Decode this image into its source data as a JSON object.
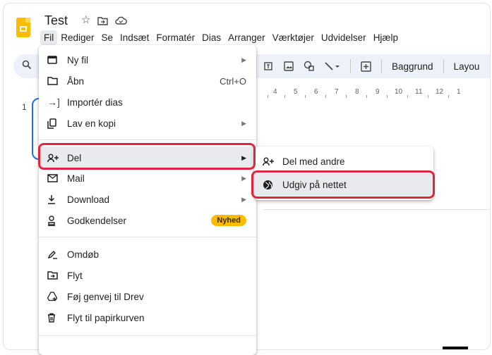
{
  "app": {
    "doc_title": "Test",
    "title_icons": [
      "star-icon",
      "move-to-folder-icon",
      "cloud-status-icon"
    ]
  },
  "menubar": {
    "items": [
      "Fil",
      "Rediger",
      "Se",
      "Indsæt",
      "Formatér",
      "Dias",
      "Arranger",
      "Værktøjer",
      "Udvidelser",
      "Hjælp"
    ]
  },
  "toolbar": {
    "background_label": "Baggrund",
    "layout_label": "Layou"
  },
  "ruler": {
    "numbers": [
      "4",
      "5",
      "6",
      "7",
      "8",
      "9",
      "10",
      "11",
      "12",
      "1"
    ]
  },
  "filmstrip": {
    "slide_number": "1"
  },
  "file_menu": {
    "items": [
      {
        "label": "Ny fil",
        "icon": "slides-icon",
        "has_submenu": true
      },
      {
        "label": "Åbn",
        "icon": "folder-icon",
        "shortcut": "Ctrl+O"
      },
      {
        "label": "Importér dias",
        "icon": "import-icon"
      },
      {
        "label": "Lav en kopi",
        "icon": "copy-icon",
        "has_submenu": true
      },
      {
        "label": "Del",
        "icon": "person-add-icon",
        "has_submenu": true
      },
      {
        "label": "Mail",
        "icon": "mail-icon",
        "has_submenu": true
      },
      {
        "label": "Download",
        "icon": "download-icon",
        "has_submenu": true
      },
      {
        "label": "Godkendelser",
        "icon": "approvals-icon",
        "badge": "Nyhed"
      },
      {
        "label": "Omdøb",
        "icon": "rename-icon"
      },
      {
        "label": "Flyt",
        "icon": "move-folder-icon"
      },
      {
        "label": "Føj genvej til Drev",
        "icon": "drive-shortcut-icon"
      },
      {
        "label": "Flyt til papirkurven",
        "icon": "trash-icon"
      }
    ]
  },
  "share_submenu": {
    "items": [
      {
        "label": "Del med andre",
        "icon": "person-add-icon"
      },
      {
        "label": "Udgiv på nettet",
        "icon": "globe-icon"
      }
    ]
  },
  "colors": {
    "accent_blue": "#1a73e8",
    "highlight_red": "#e0263c",
    "badge_yellow": "#fbbc04",
    "toolbar_bg": "#edf2fa"
  }
}
